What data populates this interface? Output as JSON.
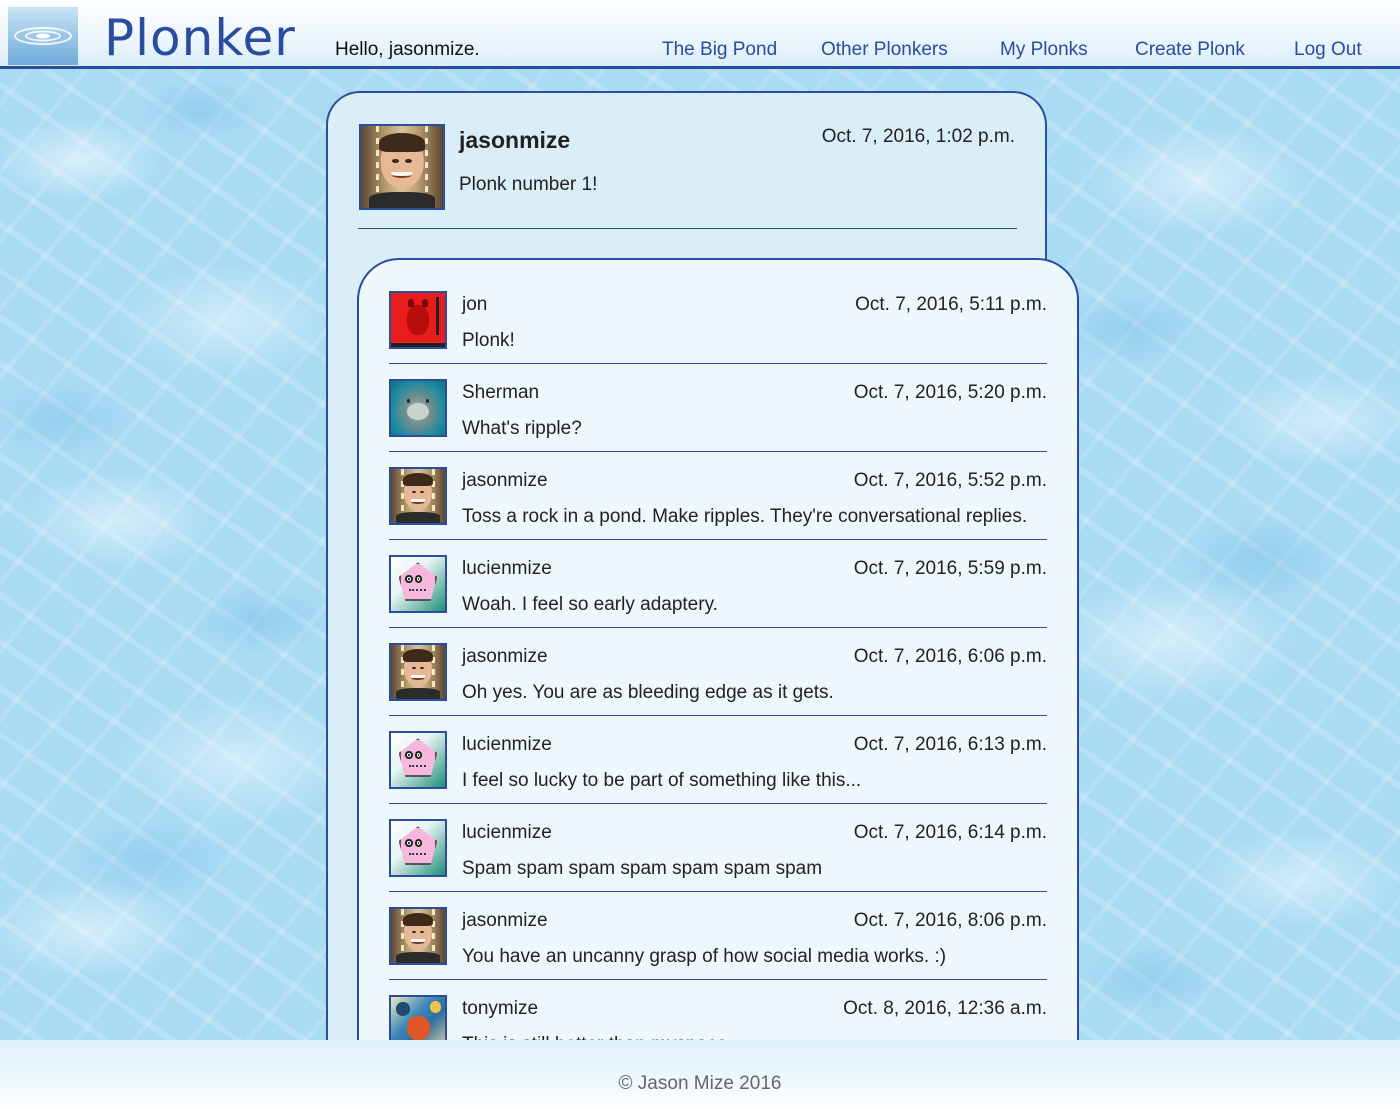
{
  "header": {
    "brand": "Plonker",
    "greeting": "Hello, jasonmize.",
    "nav": [
      {
        "label": "The Big Pond"
      },
      {
        "label": "Other Plonkers"
      },
      {
        "label": "My Plonks"
      },
      {
        "label": "Create Plonk"
      },
      {
        "label": "Log Out"
      }
    ]
  },
  "plonk": {
    "author": "jasonmize",
    "date": "Oct. 7, 2016, 1:02 p.m.",
    "body": "Plonk number 1!",
    "avatar_icon": "user-photo-icon"
  },
  "ripples": [
    {
      "author": "jon",
      "date": "Oct. 7, 2016, 5:11 p.m.",
      "body": "Plonk!",
      "avatar_icon": "devil-avatar-icon"
    },
    {
      "author": "Sherman",
      "date": "Oct. 7, 2016, 5:20 p.m.",
      "body": "What's ripple?",
      "avatar_icon": "manatee-avatar-icon"
    },
    {
      "author": "jasonmize",
      "date": "Oct. 7, 2016, 5:52 p.m.",
      "body": "Toss a rock in a pond. Make ripples. They're conversational replies.",
      "avatar_icon": "user-photo-icon"
    },
    {
      "author": "lucienmize",
      "date": "Oct. 7, 2016, 5:59 p.m.",
      "body": "Woah. I feel so early adaptery.",
      "avatar_icon": "monster-avatar-icon"
    },
    {
      "author": "jasonmize",
      "date": "Oct. 7, 2016, 6:06 p.m.",
      "body": "Oh yes. You are as bleeding edge as it gets.",
      "avatar_icon": "user-photo-icon"
    },
    {
      "author": "lucienmize",
      "date": "Oct. 7, 2016, 6:13 p.m.",
      "body": "I feel so lucky to be part of something like this...",
      "avatar_icon": "monster-avatar-icon"
    },
    {
      "author": "lucienmize",
      "date": "Oct. 7, 2016, 6:14 p.m.",
      "body": "Spam spam spam spam spam spam spam",
      "avatar_icon": "monster-avatar-icon"
    },
    {
      "author": "jasonmize",
      "date": "Oct. 7, 2016, 8:06 p.m.",
      "body": "You have an uncanny grasp of how social media works. :)",
      "avatar_icon": "user-photo-icon"
    },
    {
      "author": "tonymize",
      "date": "Oct. 8, 2016, 12:36 a.m.",
      "body": "This is still better than myspace",
      "avatar_icon": "art-avatar-icon"
    }
  ],
  "footer": {
    "copyright": "© Jason Mize 2016"
  },
  "colors": {
    "accent": "#2a4d9e",
    "card": "#daeef8",
    "ripple_card": "#eef7fc"
  }
}
